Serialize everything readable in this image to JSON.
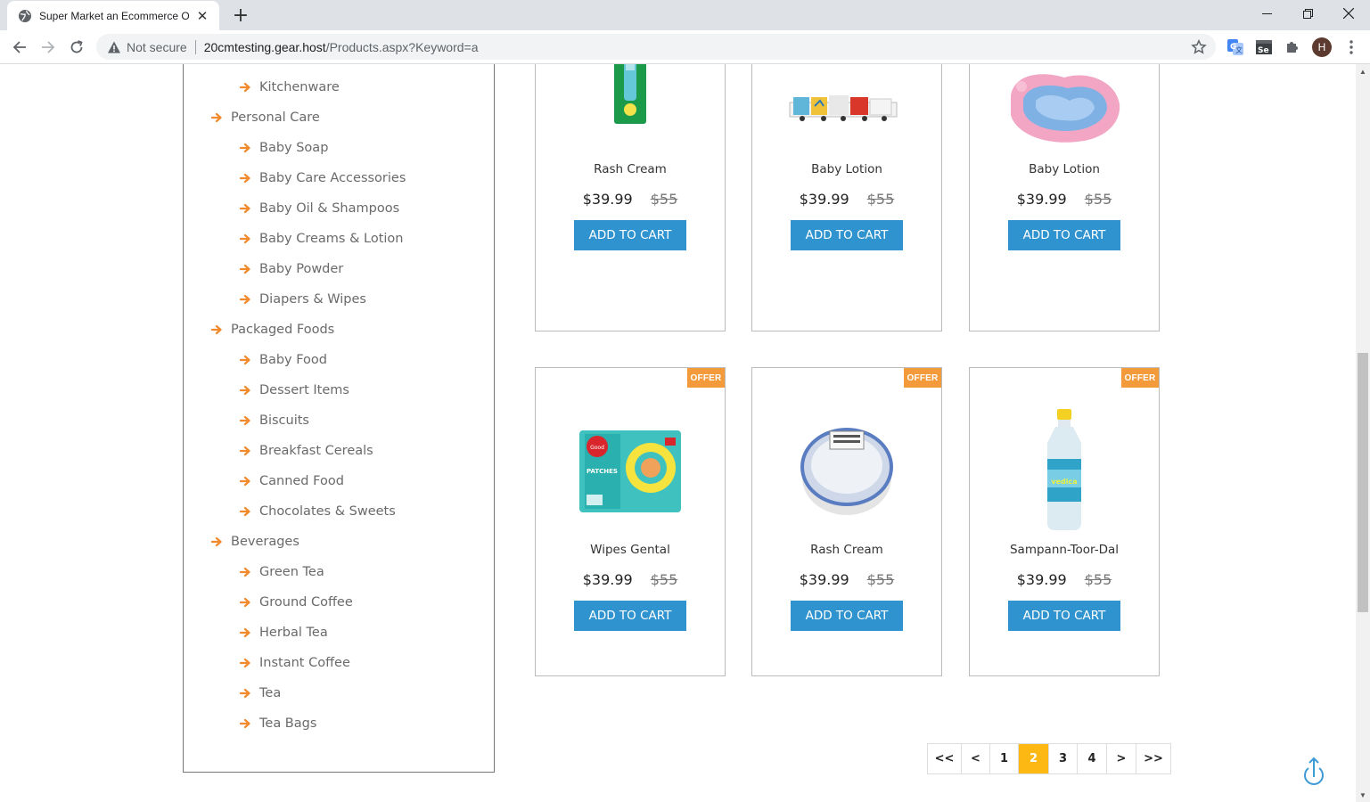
{
  "browser": {
    "tab_title": "Super Market an Ecommerce Onl",
    "security_label": "Not secure",
    "url_host": "20cmtesting.gear.host",
    "url_path": "/Products.aspx?Keyword=a",
    "profile_initial": "H"
  },
  "sidebar": {
    "items": [
      {
        "label": "Kitchenware",
        "level": 2
      },
      {
        "label": "Personal Care",
        "level": 1
      },
      {
        "label": "Baby Soap",
        "level": 2
      },
      {
        "label": "Baby Care Accessories",
        "level": 2
      },
      {
        "label": "Baby Oil & Shampoos",
        "level": 2
      },
      {
        "label": "Baby Creams & Lotion",
        "level": 2
      },
      {
        "label": "Baby Powder",
        "level": 2
      },
      {
        "label": "Diapers & Wipes",
        "level": 2
      },
      {
        "label": "Packaged Foods",
        "level": 1
      },
      {
        "label": "Baby Food",
        "level": 2
      },
      {
        "label": "Dessert Items",
        "level": 2
      },
      {
        "label": "Biscuits",
        "level": 2
      },
      {
        "label": "Breakfast Cereals",
        "level": 2
      },
      {
        "label": "Canned Food",
        "level": 2
      },
      {
        "label": "Chocolates & Sweets",
        "level": 2
      },
      {
        "label": "Beverages",
        "level": 1
      },
      {
        "label": "Green Tea",
        "level": 2
      },
      {
        "label": "Ground Coffee",
        "level": 2
      },
      {
        "label": "Herbal Tea",
        "level": 2
      },
      {
        "label": "Instant Coffee",
        "level": 2
      },
      {
        "label": "Tea",
        "level": 2
      },
      {
        "label": "Tea Bags",
        "level": 2
      }
    ]
  },
  "products": [
    {
      "name": "Rash Cream",
      "price": "$39.99",
      "old_price": "$55",
      "button": "ADD TO CART",
      "offer": "",
      "image": "repellent-bottle"
    },
    {
      "name": "Baby Lotion",
      "price": "$39.99",
      "old_price": "$55",
      "button": "ADD TO CART",
      "offer": "",
      "image": "toy-train"
    },
    {
      "name": "Baby Lotion",
      "price": "$39.99",
      "old_price": "$55",
      "button": "ADD TO CART",
      "offer": "",
      "image": "baby-bath-seat"
    },
    {
      "name": "Wipes Gental",
      "price": "$39.99",
      "old_price": "$55",
      "button": "ADD TO CART",
      "offer": "OFFER",
      "image": "patches-box"
    },
    {
      "name": "Rash Cream",
      "price": "$39.99",
      "old_price": "$55",
      "button": "ADD TO CART",
      "offer": "OFFER",
      "image": "powder-puff"
    },
    {
      "name": "Sampann-Toor-Dal",
      "price": "$39.99",
      "old_price": "$55",
      "button": "ADD TO CART",
      "offer": "OFFER",
      "image": "water-bottle"
    }
  ],
  "pagination": {
    "items": [
      "<<",
      "<",
      "1",
      "2",
      "3",
      "4",
      ">",
      ">>"
    ],
    "active": "2"
  },
  "colors": {
    "accent_orange": "#f39a3b",
    "button_blue": "#2f93cf",
    "pager_active": "#fdb813"
  }
}
